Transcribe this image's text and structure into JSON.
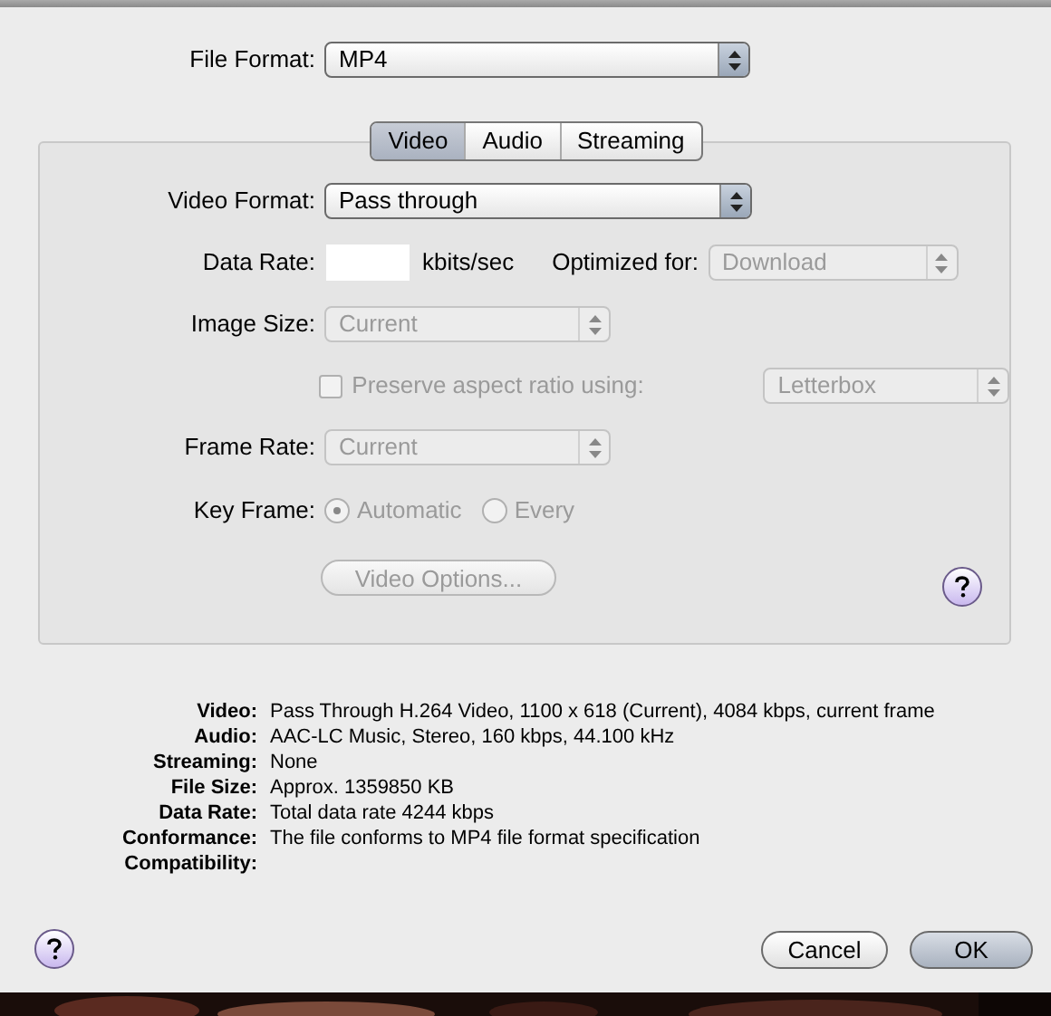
{
  "file_format": {
    "label": "File Format:",
    "value": "MP4"
  },
  "tabs": [
    {
      "label": "Video",
      "selected": true
    },
    {
      "label": "Audio",
      "selected": false
    },
    {
      "label": "Streaming",
      "selected": false
    }
  ],
  "video": {
    "video_format": {
      "label": "Video Format:",
      "value": "Pass through",
      "disabled": false
    },
    "data_rate": {
      "label": "Data Rate:",
      "unit": "kbits/sec",
      "disabled": false
    },
    "optimized_for": {
      "label": "Optimized for:",
      "value": "Download",
      "disabled": true
    },
    "image_size": {
      "label": "Image Size:",
      "value": "Current",
      "disabled": true
    },
    "preserve_aspect": {
      "label": "Preserve aspect ratio using:",
      "checked": false,
      "disabled": true
    },
    "aspect_mode": {
      "value": "Letterbox",
      "disabled": true
    },
    "frame_rate": {
      "label": "Frame Rate:",
      "value": "Current",
      "disabled": true
    },
    "key_frame": {
      "label": "Key Frame:",
      "options": [
        {
          "label": "Automatic",
          "selected": true,
          "disabled": true
        },
        {
          "label": "Every",
          "selected": false,
          "disabled": true
        }
      ]
    },
    "options_button": {
      "label": "Video Options...",
      "disabled": true
    }
  },
  "summary": [
    {
      "label": "Video:",
      "value": "Pass Through H.264 Video, 1100 x 618 (Current), 4084 kbps, current frame"
    },
    {
      "label": "Audio:",
      "value": "AAC-LC Music, Stereo, 160 kbps, 44.100 kHz"
    },
    {
      "label": "Streaming:",
      "value": "None"
    },
    {
      "label": "File Size:",
      "value": "Approx. 1359850 KB"
    },
    {
      "label": "Data Rate:",
      "value": "Total data rate 4244 kbps"
    },
    {
      "label": "Conformance:",
      "value": "The file conforms to MP4 file format specification"
    },
    {
      "label": "Compatibility:"
    }
  ],
  "buttons": [
    {
      "label": "Cancel",
      "kind": "cancel"
    },
    {
      "label": "OK",
      "kind": "default"
    }
  ]
}
